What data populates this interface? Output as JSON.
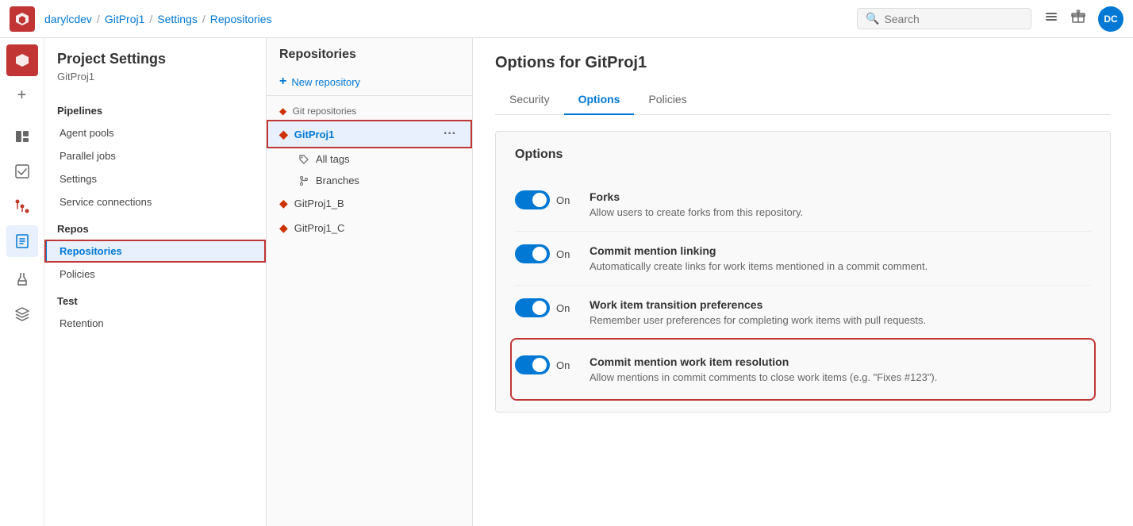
{
  "topbar": {
    "org": "darylcdev",
    "sep1": "/",
    "project": "GitProj1",
    "sep2": "/",
    "settings": "Settings",
    "sep3": "/",
    "repositories": "Repositories",
    "search_placeholder": "Search",
    "avatar_initials": "DC"
  },
  "sidebar": {
    "title": "Project Settings",
    "subtitle": "GitProj1",
    "sections": [
      {
        "header": "Pipelines",
        "items": [
          {
            "label": "Agent pools",
            "active": false
          },
          {
            "label": "Parallel jobs",
            "active": false
          },
          {
            "label": "Settings",
            "active": false
          },
          {
            "label": "Service connections",
            "active": false
          }
        ]
      },
      {
        "header": "Repos",
        "items": [
          {
            "label": "Repositories",
            "active": true
          },
          {
            "label": "Policies",
            "active": false
          }
        ]
      },
      {
        "header": "Test",
        "items": [
          {
            "label": "Retention",
            "active": false
          }
        ]
      }
    ]
  },
  "repo_panel": {
    "title": "Repositories",
    "new_button_label": "New repository",
    "section_label": "Git repositories",
    "repos": [
      {
        "name": "GitProj1",
        "active": true,
        "has_children": true
      },
      {
        "name": "GitProj1_B",
        "active": false
      },
      {
        "name": "GitProj1_C",
        "active": false
      }
    ],
    "sub_items": [
      {
        "label": "All tags",
        "icon": "tag"
      },
      {
        "label": "Branches",
        "icon": "branch"
      }
    ]
  },
  "content": {
    "title": "Options for GitProj1",
    "tabs": [
      {
        "label": "Security",
        "active": false
      },
      {
        "label": "Options",
        "active": true
      },
      {
        "label": "Policies",
        "active": false
      }
    ],
    "options_title": "Options",
    "options": [
      {
        "id": "forks",
        "name": "Forks",
        "desc": "Allow users to create forks from this repository.",
        "on": true,
        "label_on": "On",
        "highlighted": false
      },
      {
        "id": "commit-mention-linking",
        "name": "Commit mention linking",
        "desc": "Automatically create links for work items mentioned in a commit comment.",
        "on": true,
        "label_on": "On",
        "highlighted": false
      },
      {
        "id": "work-item-transition",
        "name": "Work item transition preferences",
        "desc": "Remember user preferences for completing work items with pull requests.",
        "on": true,
        "label_on": "On",
        "highlighted": false
      },
      {
        "id": "commit-mention-resolution",
        "name": "Commit mention work item resolution",
        "desc": "Allow mentions in commit comments to close work items (e.g. \"Fixes #123\").",
        "on": true,
        "label_on": "On",
        "highlighted": true
      }
    ]
  },
  "icons": {
    "search": "🔍",
    "list": "☰",
    "gift": "🎁",
    "git_repo": "◆",
    "tag": "🏷",
    "branch": "⎇",
    "plus": "+",
    "more": "···"
  }
}
